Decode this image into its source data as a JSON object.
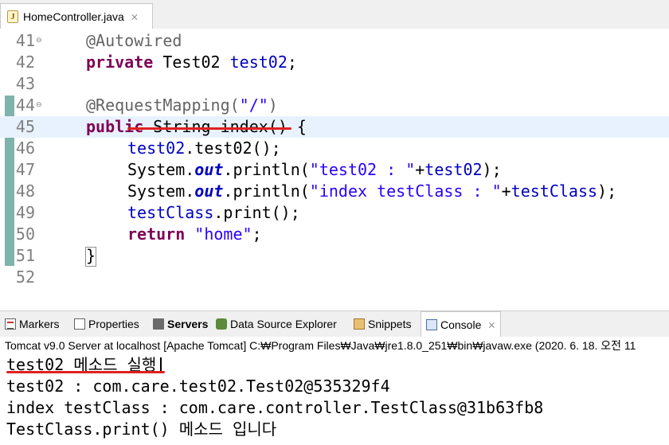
{
  "editor": {
    "tab_title": "HomeController.java",
    "tab_close": "⨯",
    "lines": [
      {
        "num": "41",
        "fold": "⊖"
      },
      {
        "num": "42"
      },
      {
        "num": "43"
      },
      {
        "num": "44",
        "fold": "⊖"
      },
      {
        "num": "45"
      },
      {
        "num": "46"
      },
      {
        "num": "47"
      },
      {
        "num": "48"
      },
      {
        "num": "49"
      },
      {
        "num": "50"
      },
      {
        "num": "51"
      },
      {
        "num": "52"
      }
    ],
    "code": {
      "l41_annotation": "@Autowired",
      "l42_kw": "private",
      "l42_type": " Test02 ",
      "l42_field": "test02",
      "l42_end": ";",
      "l44_annotation": "@RequestMapping(",
      "l44_str": "\"/\"",
      "l44_end": ")",
      "l45_kw": "public",
      "l45_rest": " String index() {",
      "l46_field": "test02",
      "l46_rest": ".test02();",
      "l47_a": "System.",
      "l47_out": "out",
      "l47_b": ".println(",
      "l47_str": "\"test02 : \"",
      "l47_plus": "+",
      "l47_field": "test02",
      "l47_end": ");",
      "l48_a": "System.",
      "l48_out": "out",
      "l48_b": ".println(",
      "l48_str": "\"index testClass : \"",
      "l48_plus": "+",
      "l48_field": "testClass",
      "l48_end": ");",
      "l49_field": "testClass",
      "l49_rest": ".print();",
      "l50_kw": "return",
      "l50_sp": " ",
      "l50_str": "\"home\"",
      "l50_end": ";",
      "l51_brace": "}"
    },
    "scroll_arrow": "<"
  },
  "panel": {
    "tabs": [
      {
        "label": "Markers"
      },
      {
        "label": "Properties"
      },
      {
        "label": "Servers"
      },
      {
        "label": "Data Source Explorer"
      },
      {
        "label": "Snippets"
      },
      {
        "label": "Console"
      }
    ],
    "console_close": "⨯",
    "console_header": "Tomcat v9.0 Server at localhost [Apache Tomcat] C:₩Program Files₩Java₩jre1.8.0_251₩bin₩javaw.exe  (2020. 6. 18. 오전 11",
    "console_lines": [
      "test02 메소드 실행",
      "test02 : com.care.test02.Test02@535329f4",
      "index testClass : com.care.controller.TestClass@31b63fb8",
      "TestClass.print() 메소드 입니다"
    ]
  }
}
